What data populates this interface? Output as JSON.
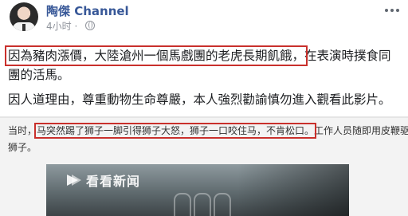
{
  "post": {
    "author": "陶傑 Channel",
    "time": "4小时",
    "globe_icon": "globe-icon",
    "more_icon": "more-horizontal-icon",
    "line1_highlight": "因為豬肉漲價，大陸滄州一個馬戲團的老虎長期飢餓，",
    "line1_rest": "在表演時撲食同",
    "line2": "團的活馬。",
    "line3": "因人道理由，尊重動物生命尊嚴，本人強烈勸諭慎勿進入觀看此影片。"
  },
  "article": {
    "line1_prefix": "当时，",
    "line1_highlight": "马突然踢了狮子一脚引得狮子大怒，狮子一口咬住马，不肯松口。",
    "line1_rest": "工作人员随即用皮鞭驱赶",
    "line2": "狮子。"
  },
  "video": {
    "logo_text": "看看新闻",
    "logo_icon": "kankan-news-logo-icon"
  },
  "colors": {
    "link": "#385898",
    "highlight_border": "#c9302c",
    "text": "#1c1e21",
    "meta": "#90949c"
  }
}
